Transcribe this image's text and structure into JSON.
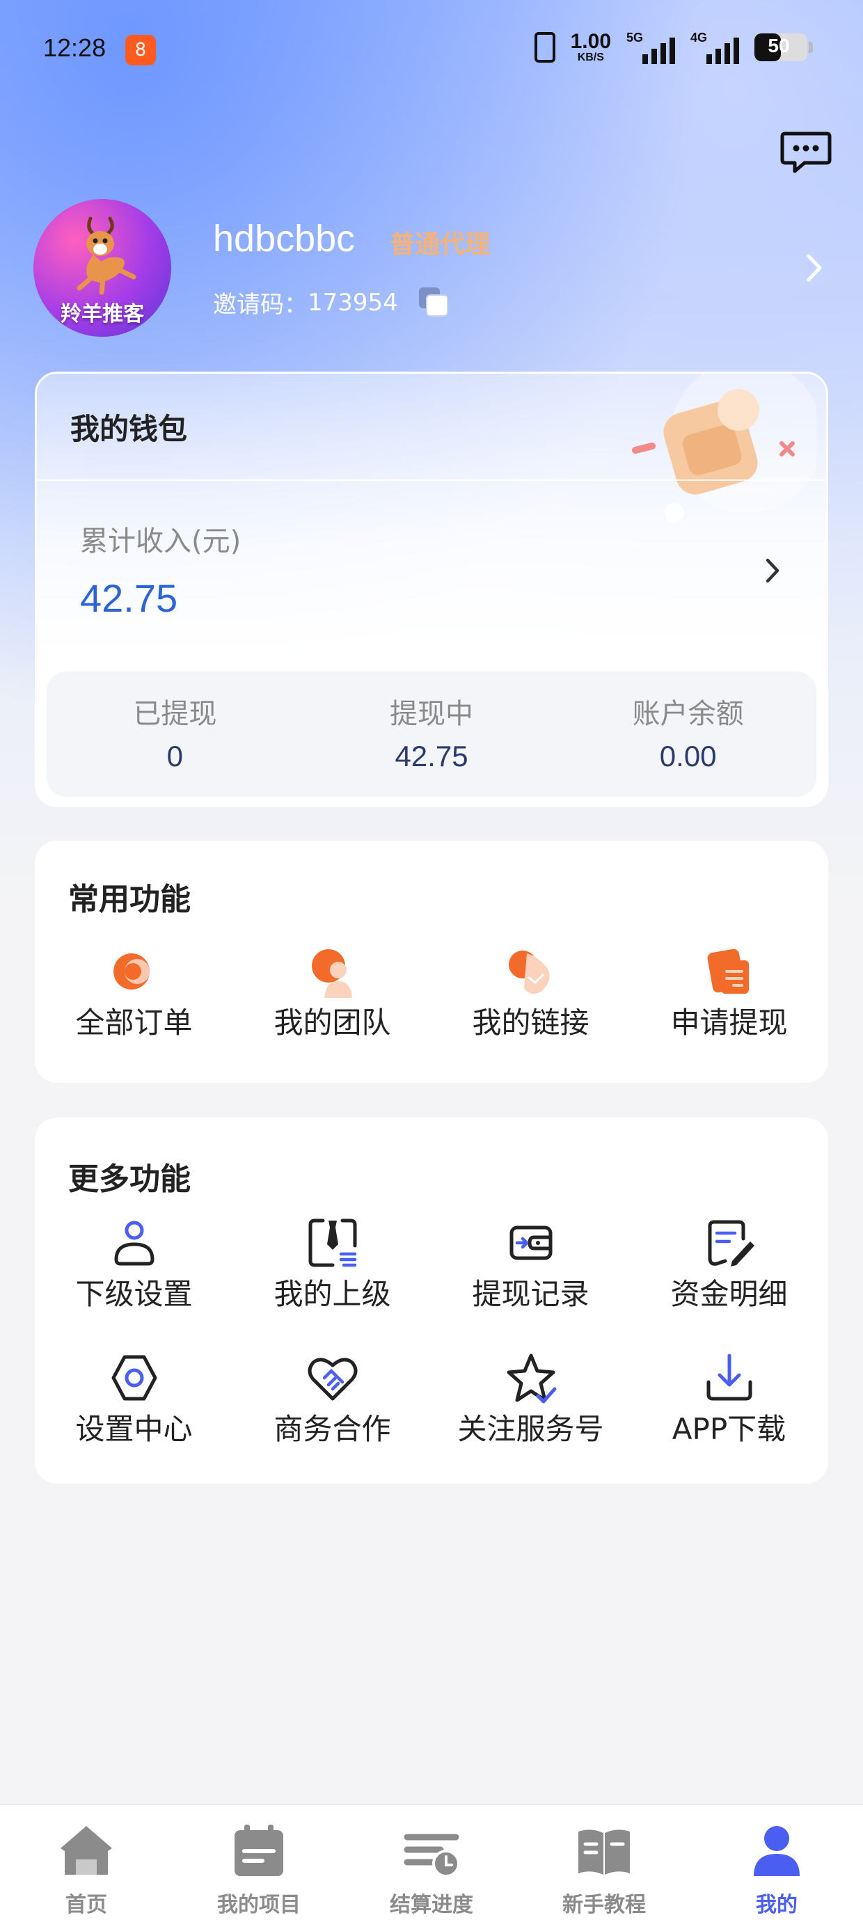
{
  "status_bar": {
    "time": "12:28",
    "app_badge": "8",
    "net_speed_value": "1.00",
    "net_speed_unit": "KB/S",
    "signal_1": "5G",
    "signal_2": "4G",
    "battery": "50"
  },
  "profile": {
    "username": "hdbcbbc",
    "level": "普通代理",
    "invite_label": "邀请码：",
    "invite_code": "173954",
    "avatar_text": "羚羊推客"
  },
  "wallet": {
    "title": "我的钱包",
    "total_label": "累计收入(元)",
    "total_value": "42.75",
    "stats": [
      {
        "label": "已提现",
        "value": "0"
      },
      {
        "label": "提现中",
        "value": "42.75"
      },
      {
        "label": "账户余额",
        "value": "0.00"
      }
    ]
  },
  "common_functions": {
    "title": "常用功能",
    "items": [
      {
        "label": "全部订单",
        "icon": "orders-icon"
      },
      {
        "label": "我的团队",
        "icon": "team-icon"
      },
      {
        "label": "我的链接",
        "icon": "link-icon"
      },
      {
        "label": "申请提现",
        "icon": "withdraw-icon"
      }
    ]
  },
  "more_functions": {
    "title": "更多功能",
    "items": [
      {
        "label": "下级设置",
        "icon": "user-icon"
      },
      {
        "label": "我的上级",
        "icon": "superior-icon"
      },
      {
        "label": "提现记录",
        "icon": "wallet-record-icon"
      },
      {
        "label": "资金明细",
        "icon": "document-edit-icon"
      },
      {
        "label": "设置中心",
        "icon": "hexagon-settings-icon"
      },
      {
        "label": "商务合作",
        "icon": "handshake-heart-icon"
      },
      {
        "label": "关注服务号",
        "icon": "star-check-icon"
      },
      {
        "label": "APP下载",
        "icon": "download-icon"
      }
    ]
  },
  "tabbar": {
    "items": [
      {
        "label": "首页",
        "icon": "home-icon"
      },
      {
        "label": "我的项目",
        "icon": "projects-icon"
      },
      {
        "label": "结算进度",
        "icon": "settlement-icon"
      },
      {
        "label": "新手教程",
        "icon": "tutorial-book-icon"
      },
      {
        "label": "我的",
        "icon": "profile-icon"
      }
    ],
    "active_index": 4,
    "active_color": "#4a5ff2",
    "inactive_color": "#8b8b8b"
  },
  "colors": {
    "accent_blue": "#2c64d6",
    "level_orange": "#f5b37a",
    "function_orange": "#f26b2a"
  }
}
